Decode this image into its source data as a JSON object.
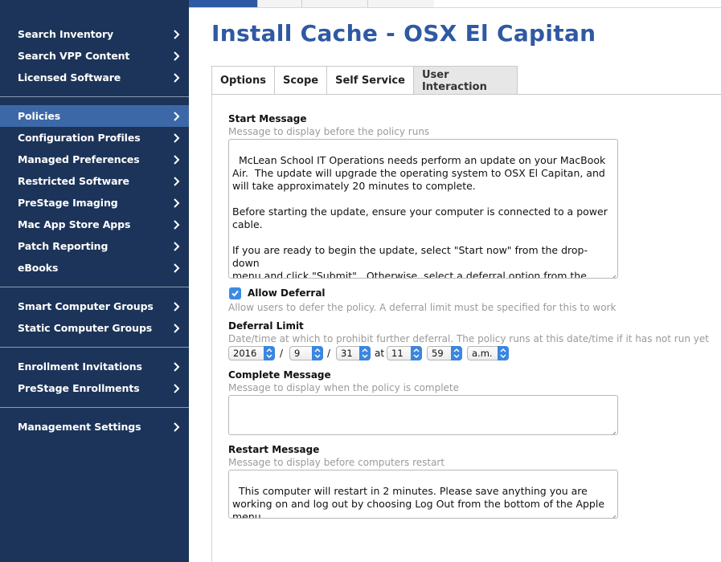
{
  "sidebar": {
    "items": [
      {
        "label": "Search Inventory"
      },
      {
        "label": "Search VPP Content"
      },
      {
        "label": "Licensed Software"
      },
      {
        "label": "Policies"
      },
      {
        "label": "Configuration Profiles"
      },
      {
        "label": "Managed Preferences"
      },
      {
        "label": "Restricted Software"
      },
      {
        "label": "PreStage Imaging"
      },
      {
        "label": "Mac App Store Apps"
      },
      {
        "label": "Patch Reporting"
      },
      {
        "label": "eBooks"
      },
      {
        "label": "Smart Computer Groups"
      },
      {
        "label": "Static Computer Groups"
      },
      {
        "label": "Enrollment Invitations"
      },
      {
        "label": "PreStage Enrollments"
      },
      {
        "label": "Management Settings"
      }
    ],
    "active_item": "Policies"
  },
  "page": {
    "title": "Install Cache - OSX El Capitan"
  },
  "tabs": [
    {
      "label": "Options"
    },
    {
      "label": "Scope"
    },
    {
      "label": "Self Service"
    },
    {
      "label": "User Interaction"
    }
  ],
  "active_tab": "User Interaction",
  "form": {
    "start_message": {
      "label": "Start Message",
      "help": "Message to display before the policy runs",
      "value": "McLean School IT Operations needs perform an update on your MacBook\nAir.  The update will upgrade the operating system to OSX El Capitan, and\nwill take approximately 20 minutes to complete.\n\nBefore starting the update, ensure your computer is connected to a power\ncable.\n\nIf you are ready to begin the update, select \"Start now\" from the drop-down\nmenu and click \"Submit\".  Otherwise, select a deferral option from the\ndrop-down menu and click \"Submit\"."
    },
    "allow_deferral": {
      "label": "Allow Deferral",
      "checked": true,
      "help": "Allow users to defer the policy. A deferral limit must be specified for this to work"
    },
    "deferral_limit": {
      "label": "Deferral Limit",
      "help": "Date/time at which to prohibit further deferral. The policy runs at this date/time if it has not run yet",
      "year": "2016",
      "month": "9",
      "day": "31",
      "at_label": "at",
      "hour": "11",
      "minute": "59",
      "ampm": "a.m.",
      "sep": "/"
    },
    "complete_message": {
      "label": "Complete Message",
      "help": "Message to display when the policy is complete",
      "value": ""
    },
    "restart_message": {
      "label": "Restart Message",
      "help": "Message to display before computers restart",
      "value": "This computer will restart in 2 minutes. Please save anything you are\nworking on and log out by choosing Log Out from the bottom of the Apple\nmenu."
    }
  },
  "colors": {
    "sidebar_bg": "#1c3459",
    "sidebar_active": "#3d68a8",
    "title": "#2f59a2",
    "accent": "#3b86e0"
  }
}
